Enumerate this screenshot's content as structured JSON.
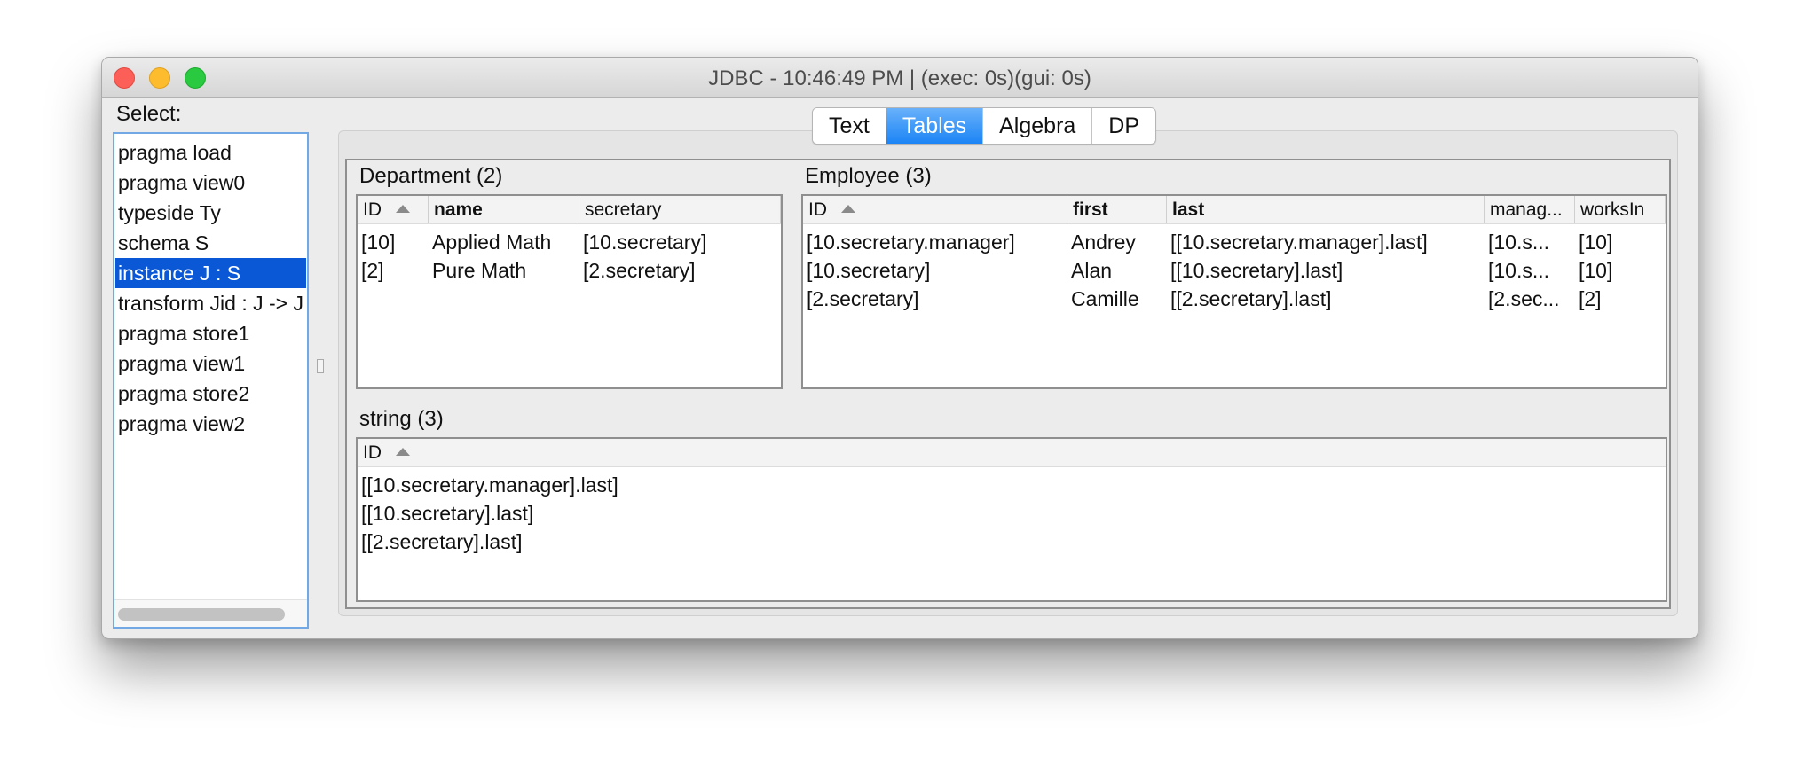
{
  "window": {
    "title": "JDBC - 10:46:49 PM | (exec: 0s)(gui: 0s)"
  },
  "sidebar": {
    "label": "Select:",
    "items": [
      {
        "label": "pragma load"
      },
      {
        "label": "pragma view0"
      },
      {
        "label": "typeside Ty"
      },
      {
        "label": "schema S"
      },
      {
        "label": "instance J : S",
        "selected": true
      },
      {
        "label": "transform Jid : J -> J"
      },
      {
        "label": "pragma store1"
      },
      {
        "label": "pragma view1"
      },
      {
        "label": "pragma store2"
      },
      {
        "label": "pragma view2"
      }
    ]
  },
  "tabs": [
    {
      "label": "Text"
    },
    {
      "label": "Tables",
      "active": true
    },
    {
      "label": "Algebra"
    },
    {
      "label": "DP"
    }
  ],
  "department": {
    "title": "Department (2)",
    "columns": [
      "ID",
      "name",
      "secretary"
    ],
    "rows": [
      [
        "[10]",
        "Applied Math",
        "[10.secretary]"
      ],
      [
        "[2]",
        "Pure Math",
        "[2.secretary]"
      ]
    ]
  },
  "employee": {
    "title": "Employee (3)",
    "columns": [
      "ID",
      "first",
      "last",
      "manag...",
      "worksIn"
    ],
    "rows": [
      [
        "[10.secretary.manager]",
        "Andrey",
        "[[10.secretary.manager].last]",
        "[10.s...",
        "[10]"
      ],
      [
        "[10.secretary]",
        "Alan",
        "[[10.secretary].last]",
        "[10.s...",
        "[10]"
      ],
      [
        "[2.secretary]",
        "Camille",
        "[[2.secretary].last]",
        "[2.sec...",
        "[2]"
      ]
    ]
  },
  "string_table": {
    "title": "string (3)",
    "columns": [
      "ID"
    ],
    "rows": [
      [
        "[[10.secretary.manager].last]"
      ],
      [
        "[[10.secretary].last]"
      ],
      [
        "[[2.secretary].last]"
      ]
    ]
  },
  "colors": {
    "selection": "#0b58d6",
    "tab_active": "#1b84f5",
    "close": "#fc5f57",
    "minimize": "#fdbc2e",
    "maximize": "#29c940"
  }
}
